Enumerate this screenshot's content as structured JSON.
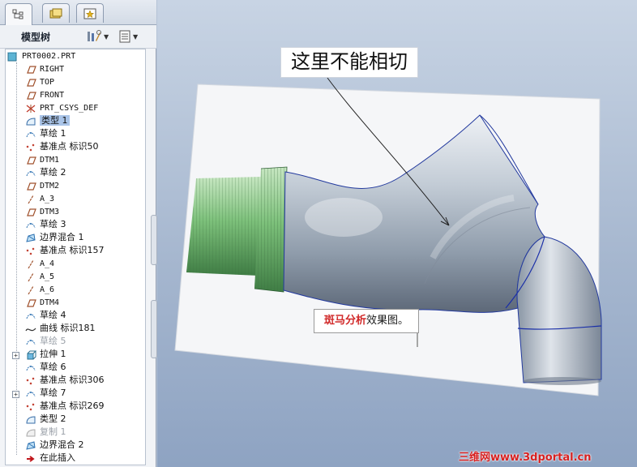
{
  "tabs": [
    {
      "name": "model-tree-tab",
      "icon": "tree-icon",
      "active": true
    },
    {
      "name": "folder-tab",
      "icon": "folder-icon",
      "active": false
    },
    {
      "name": "favorites-tab",
      "icon": "star-icon",
      "active": false
    }
  ],
  "header": {
    "title": "模型树",
    "settings_icon": "settings-icon",
    "columns_icon": "show-columns-icon"
  },
  "tree": {
    "root": "PRT0002.PRT",
    "items": [
      {
        "label": "RIGHT",
        "icon": "datum-plane-icon"
      },
      {
        "label": "TOP",
        "icon": "datum-plane-icon"
      },
      {
        "label": "FRONT",
        "icon": "datum-plane-icon"
      },
      {
        "label": "PRT_CSYS_DEF",
        "icon": "csys-icon"
      },
      {
        "label": "类型 1",
        "icon": "style-icon",
        "selected": true
      },
      {
        "label": "草绘 1",
        "icon": "sketch-icon"
      },
      {
        "label": "基准点 标识50",
        "icon": "datum-point-icon"
      },
      {
        "label": "DTM1",
        "icon": "datum-plane-icon"
      },
      {
        "label": "草绘 2",
        "icon": "sketch-icon"
      },
      {
        "label": "DTM2",
        "icon": "datum-plane-icon"
      },
      {
        "label": "A_3",
        "icon": "axis-icon"
      },
      {
        "label": "DTM3",
        "icon": "datum-plane-icon"
      },
      {
        "label": "草绘 3",
        "icon": "sketch-icon"
      },
      {
        "label": "边界混合 1",
        "icon": "boundary-blend-icon"
      },
      {
        "label": "基准点 标识157",
        "icon": "datum-point-icon"
      },
      {
        "label": "A_4",
        "icon": "axis-icon"
      },
      {
        "label": "A_5",
        "icon": "axis-icon"
      },
      {
        "label": "A_6",
        "icon": "axis-icon"
      },
      {
        "label": "DTM4",
        "icon": "datum-plane-icon"
      },
      {
        "label": "草绘 4",
        "icon": "sketch-icon"
      },
      {
        "label": "曲线 标识181",
        "icon": "curve-icon"
      },
      {
        "label": "草绘 5",
        "icon": "sketch-icon",
        "dim": true
      },
      {
        "label": "拉伸 1",
        "icon": "extrude-icon",
        "expandable": true
      },
      {
        "label": "草绘 6",
        "icon": "sketch-icon"
      },
      {
        "label": "基准点 标识306",
        "icon": "datum-point-icon"
      },
      {
        "label": "草绘 7",
        "icon": "sketch-icon",
        "expandable": true
      },
      {
        "label": "基准点 标识269",
        "icon": "datum-point-icon"
      },
      {
        "label": "类型 2",
        "icon": "style-icon"
      },
      {
        "label": "复制 1",
        "icon": "copy-icon",
        "dim": true
      },
      {
        "label": "边界混合 2",
        "icon": "boundary-blend-icon"
      },
      {
        "label": "在此插入",
        "icon": "insert-here-arrow-icon"
      }
    ]
  },
  "viewport": {
    "callout": "这里不能相切",
    "caption_red": "斑马分析",
    "caption_rest": "效果图。",
    "watermark": "三维网www.3dportal.cn"
  },
  "colors": {
    "selection": "#a9c4e8",
    "model_surface": "#b8c2cc",
    "thread_green": "#7cc07a",
    "edge_blue": "#1a2fa8",
    "watermark_red": "#d72020"
  }
}
